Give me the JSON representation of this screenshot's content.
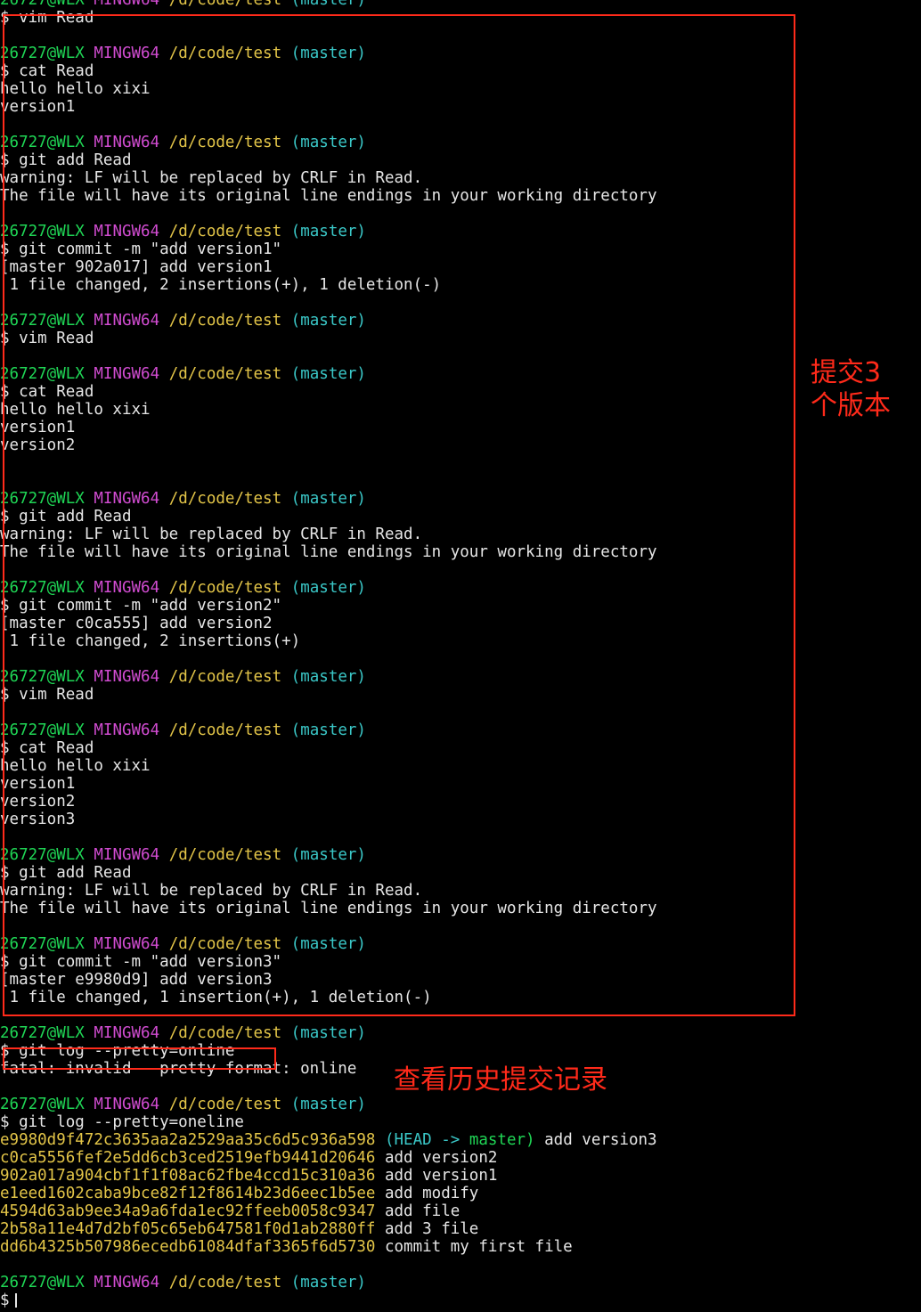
{
  "prompt": {
    "user": "26727@WLX",
    "host": "MINGW64",
    "path": "/d/code/test",
    "branch": "(master)"
  },
  "lines": [
    {
      "kind": "prompt"
    },
    {
      "kind": "text",
      "text": "$ vim Read"
    },
    {
      "kind": "blank"
    },
    {
      "kind": "prompt"
    },
    {
      "kind": "text",
      "text": "$ cat Read"
    },
    {
      "kind": "text",
      "text": "hello hello xixi"
    },
    {
      "kind": "text",
      "text": "version1"
    },
    {
      "kind": "blank"
    },
    {
      "kind": "prompt"
    },
    {
      "kind": "text",
      "text": "$ git add Read"
    },
    {
      "kind": "text",
      "text": "warning: LF will be replaced by CRLF in Read."
    },
    {
      "kind": "text",
      "text": "The file will have its original line endings in your working directory"
    },
    {
      "kind": "blank"
    },
    {
      "kind": "prompt"
    },
    {
      "kind": "text",
      "text": "$ git commit -m \"add version1\""
    },
    {
      "kind": "text",
      "text": "[master 902a017] add version1"
    },
    {
      "kind": "text",
      "text": " 1 file changed, 2 insertions(+), 1 deletion(-)"
    },
    {
      "kind": "blank"
    },
    {
      "kind": "prompt"
    },
    {
      "kind": "text",
      "text": "$ vim Read"
    },
    {
      "kind": "blank"
    },
    {
      "kind": "prompt"
    },
    {
      "kind": "text",
      "text": "$ cat Read"
    },
    {
      "kind": "text",
      "text": "hello hello xixi"
    },
    {
      "kind": "text",
      "text": "version1"
    },
    {
      "kind": "text",
      "text": "version2"
    },
    {
      "kind": "blank"
    },
    {
      "kind": "blank"
    },
    {
      "kind": "prompt"
    },
    {
      "kind": "text",
      "text": "$ git add Read"
    },
    {
      "kind": "text",
      "text": "warning: LF will be replaced by CRLF in Read."
    },
    {
      "kind": "text",
      "text": "The file will have its original line endings in your working directory"
    },
    {
      "kind": "blank"
    },
    {
      "kind": "prompt"
    },
    {
      "kind": "text",
      "text": "$ git commit -m \"add version2\""
    },
    {
      "kind": "text",
      "text": "[master c0ca555] add version2"
    },
    {
      "kind": "text",
      "text": " 1 file changed, 2 insertions(+)"
    },
    {
      "kind": "blank"
    },
    {
      "kind": "prompt"
    },
    {
      "kind": "text",
      "text": "$ vim Read"
    },
    {
      "kind": "blank"
    },
    {
      "kind": "prompt"
    },
    {
      "kind": "text",
      "text": "$ cat Read"
    },
    {
      "kind": "text",
      "text": "hello hello xixi"
    },
    {
      "kind": "text",
      "text": "version1"
    },
    {
      "kind": "text",
      "text": "version2"
    },
    {
      "kind": "text",
      "text": "version3"
    },
    {
      "kind": "blank"
    },
    {
      "kind": "prompt"
    },
    {
      "kind": "text",
      "text": "$ git add Read"
    },
    {
      "kind": "text",
      "text": "warning: LF will be replaced by CRLF in Read."
    },
    {
      "kind": "text",
      "text": "The file will have its original line endings in your working directory"
    },
    {
      "kind": "blank"
    },
    {
      "kind": "prompt"
    },
    {
      "kind": "text",
      "text": "$ git commit -m \"add version3\""
    },
    {
      "kind": "text",
      "text": "[master e9980d9] add version3"
    },
    {
      "kind": "text",
      "text": " 1 file changed, 1 insertion(+), 1 deletion(-)"
    },
    {
      "kind": "blank"
    },
    {
      "kind": "prompt"
    },
    {
      "kind": "text",
      "text": "$ git log --pretty=online"
    },
    {
      "kind": "text",
      "text": "fatal: invalid --pretty format: online"
    },
    {
      "kind": "blank"
    },
    {
      "kind": "prompt"
    },
    {
      "kind": "text",
      "text": "$ git log --pretty=oneline"
    },
    {
      "kind": "log",
      "hash": "e9980d9f472c3635aa2a2529aa35c6d5c936a598",
      "head": "(HEAD ->",
      "ref": "master)",
      "msg": "add version3"
    },
    {
      "kind": "log",
      "hash": "c0ca5556fef2e5dd6cb3ced2519efb9441d20646",
      "msg": "add version2"
    },
    {
      "kind": "log",
      "hash": "902a017a904cbf1f1f08ac62fbe4ccd15c310a36",
      "msg": "add version1"
    },
    {
      "kind": "log",
      "hash": "e1eed1602caba9bce82f12f8614b23d6eec1b5ee",
      "msg": "add modify"
    },
    {
      "kind": "log",
      "hash": "4594d63ab9ee34a9a6fda1ec92ffeeb0058c9347",
      "msg": "add file"
    },
    {
      "kind": "log",
      "hash": "2b58a11e4d7d2bf05c65eb647581f0d1ab2880ff",
      "msg": "add 3 file"
    },
    {
      "kind": "log",
      "hash": "dd6b4325b507986ecedb61084dfaf3365f6d5730",
      "msg": "commit my first file"
    },
    {
      "kind": "blank"
    },
    {
      "kind": "prompt"
    },
    {
      "kind": "cursor",
      "text": "$"
    }
  ],
  "annotations": {
    "commits_label": "提交3\n个版本",
    "history_label": "查看历史提交记录"
  },
  "colors": {
    "background": "#000000",
    "text": "#e6e6e6",
    "user": "#1fd655",
    "host": "#d14cd1",
    "path": "#e3c548",
    "branch": "#3ac7c7",
    "annotation": "#ff2a1a"
  }
}
